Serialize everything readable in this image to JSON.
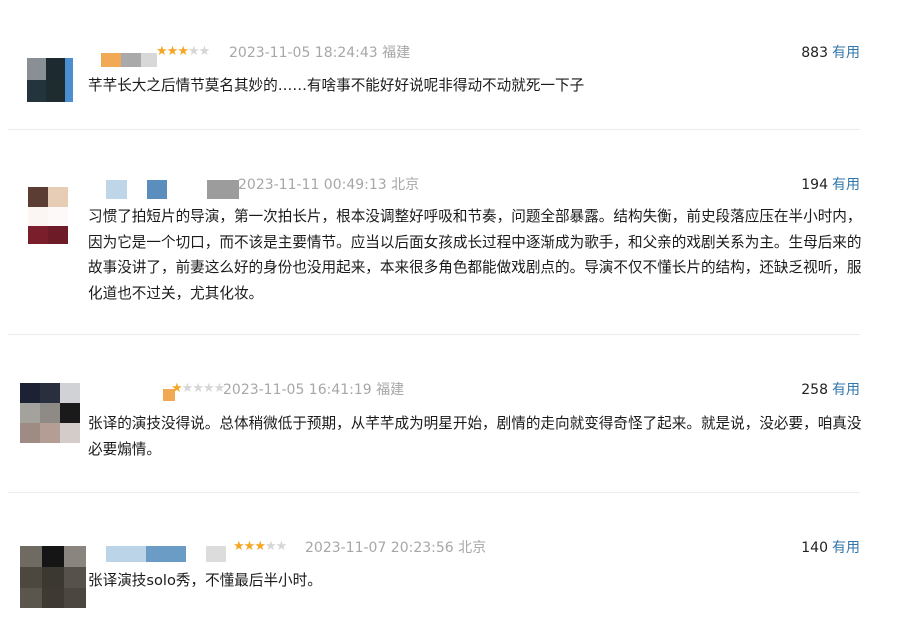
{
  "reviews": [
    {
      "rating": 3,
      "time": "2023-11-05 18:24:43",
      "location": "福建",
      "votes": "883",
      "useful_label": "有用",
      "content": "芊芊长大之后情节莫名其妙的……有啥事不能好好说呢非得动不动就死一下子",
      "avatar_colors": [
        "#8a8f96",
        "#1d2a30",
        "#4c8fd0",
        "#24343c",
        "#1e2b2f",
        "#4c8fd0"
      ],
      "name_colors": [
        "#f2a955",
        "#a9a9a9",
        "#d8d8d8"
      ]
    },
    {
      "rating": 0,
      "time": "2023-11-11 00:49:13",
      "location": "北京",
      "votes": "194",
      "useful_label": "有用",
      "content": "习惯了拍短片的导演，第一次拍长片，根本没调整好呼吸和节奏，问题全部暴露。结构失衡，前史段落应压在半小时内，因为它是一个切口，而不该是主要情节。应当以后面女孩成长过程中逐渐成为歌手，和父亲的戏剧关系为主。生母后来的故事没讲了，前妻这么好的身份也没用起来，本来很多角色都能做戏剧点的。导演不仅不懂长片的结构，还缺乏视听，服化道也不过关，尤其化妆。",
      "avatar_colors": [
        "#5b3d34",
        "#e8cdb6",
        "#fbf6f4",
        "#fdf9f8",
        "#7a1e2c",
        "#6d1b27"
      ],
      "name_colors": [
        "#bed6e8",
        "#5a8fbd",
        "#9c9c9c"
      ]
    },
    {
      "rating": 1,
      "time": "2023-11-05 16:41:19",
      "location": "福建",
      "votes": "258",
      "useful_label": "有用",
      "content": "张译的演技没得说。总体稍微低于预期，从芊芊成为明星开始，剧情的走向就变得奇怪了起来。就是说，没必要，咱真没必要煽情。",
      "avatar_colors": [
        "#1c2233",
        "#2a2f3e",
        "#d0d2d6",
        "#a4a29c",
        "#8e8a86",
        "#1a1a1a",
        "#9d8b84",
        "#b39d94",
        "#d3ccc8"
      ],
      "name_colors": [
        "#f2a955"
      ]
    },
    {
      "rating": 3,
      "time": "2023-11-07 20:23:56",
      "location": "北京",
      "votes": "140",
      "useful_label": "有用",
      "content": "张译演技solo秀，不懂最后半小时。",
      "avatar_colors": [
        "#6f6a62",
        "#151515",
        "#8a857e",
        "#4c473f",
        "#3b3731",
        "#56524b",
        "#5a554d",
        "#3e3a33",
        "#4b463f"
      ],
      "name_colors": [
        "#bcd4e8",
        "#6b9cc6",
        "#dcdcdc"
      ]
    }
  ]
}
